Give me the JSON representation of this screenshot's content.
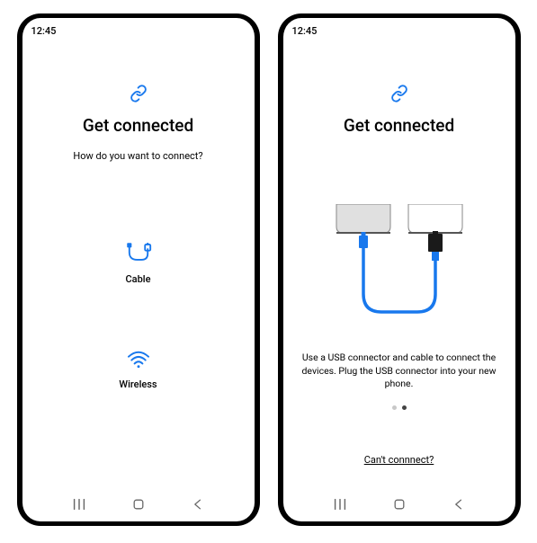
{
  "status": {
    "time": "12:45"
  },
  "left": {
    "title": "Get connected",
    "subtitle": "How do you want to connect?",
    "options": {
      "cable": "Cable",
      "wireless": "Wireless"
    }
  },
  "right": {
    "title": "Get connected",
    "instruction": "Use a USB connector and cable to connect the devices. Plug the USB connector into your new phone.",
    "help_link": "Can't connnect?",
    "pager": {
      "current": 1,
      "total": 2
    }
  },
  "colors": {
    "accent": "#1878ed"
  }
}
